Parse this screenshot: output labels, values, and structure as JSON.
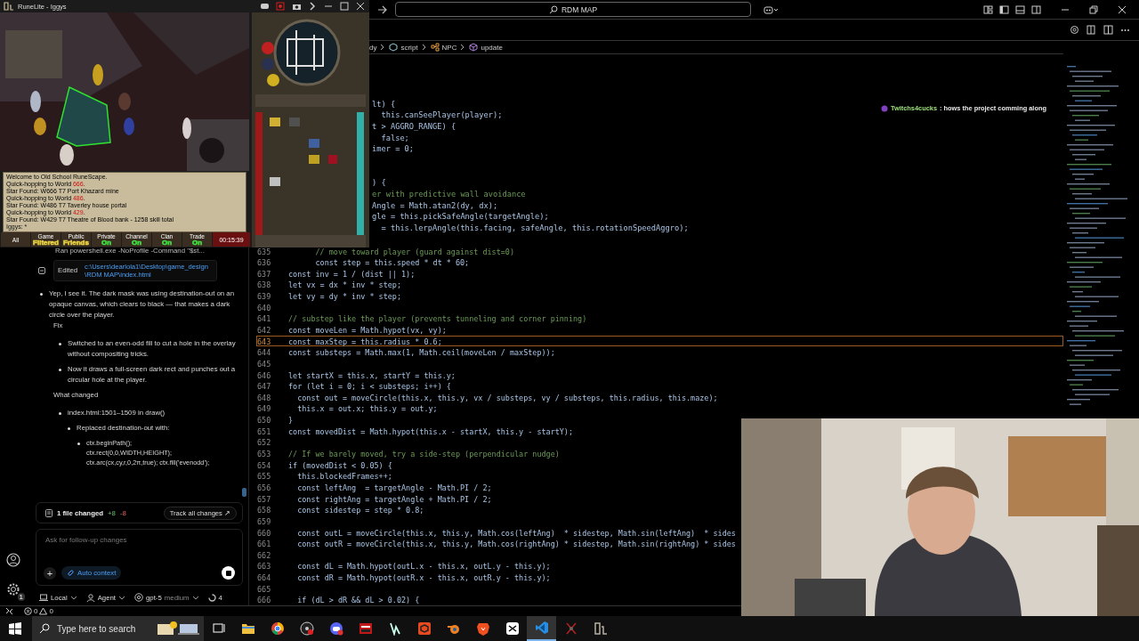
{
  "title_bar": {
    "search": "RDM MAP"
  },
  "breadcrumb": [
    {
      "kind": "plain",
      "text": "dy"
    },
    {
      "kind": "module",
      "text": "script"
    },
    {
      "kind": "class",
      "text": "NPC"
    },
    {
      "kind": "method",
      "text": "update"
    }
  ],
  "hidden_code_lines": [
    {
      "kind": "code",
      "text": "lt) {"
    },
    {
      "kind": "code",
      "text": "  this.canSeePlayer(player);"
    },
    {
      "kind": "code",
      "text": "t > AGGRO_RANGE) {"
    },
    {
      "kind": "code",
      "text": "  false;"
    },
    {
      "kind": "code",
      "text": "imer = 0;"
    },
    {
      "kind": "blank"
    },
    {
      "kind": "blank"
    },
    {
      "kind": "code",
      "text": ") {"
    },
    {
      "kind": "comment",
      "text": "er with predictive wall avoidance"
    },
    {
      "kind": "code",
      "text": "Angle = Math.atan2(dy, dx);"
    },
    {
      "kind": "code",
      "text": "gle = this.pickSafeAngle(targetAngle);"
    },
    {
      "kind": "code",
      "text": "  = this.lerpAngle(this.facing, safeAngle, this.rotationSpeedAggro);"
    }
  ],
  "code_lines": [
    {
      "number": "635",
      "kind": "comment",
      "current": false,
      "text": "      // move toward player (guard against dist=0)"
    },
    {
      "number": "636",
      "kind": "code",
      "current": false,
      "text": "      const step = this.speed * dt * 60;"
    },
    {
      "number": "637",
      "kind": "code",
      "current": false,
      "text": "const inv = 1 / (dist || 1);"
    },
    {
      "number": "638",
      "kind": "code",
      "current": false,
      "text": "let vx = dx * inv * step;"
    },
    {
      "number": "639",
      "kind": "code",
      "current": false,
      "text": "let vy = dy * inv * step;"
    },
    {
      "number": "640",
      "kind": "blank",
      "current": false
    },
    {
      "number": "641",
      "kind": "comment",
      "current": false,
      "text": "// substep like the player (prevents tunneling and corner pinning)"
    },
    {
      "number": "642",
      "kind": "code",
      "current": false,
      "text": "const moveLen = Math.hypot(vx, vy);"
    },
    {
      "number": "643",
      "kind": "code",
      "current": true,
      "text": "const maxStep = this.radius * 0.6;"
    },
    {
      "number": "644",
      "kind": "code",
      "current": false,
      "text": "const substeps = Math.max(1, Math.ceil(moveLen / maxStep));"
    },
    {
      "number": "645",
      "kind": "blank",
      "current": false
    },
    {
      "number": "646",
      "kind": "code",
      "current": false,
      "text": "let startX = this.x, startY = this.y;"
    },
    {
      "number": "647",
      "kind": "code",
      "current": false,
      "text": "for (let i = 0; i < substeps; i++) {"
    },
    {
      "number": "648",
      "kind": "code",
      "current": false,
      "text": "  const out = moveCircle(this.x, this.y, vx / substeps, vy / substeps, this.radius, this.maze);"
    },
    {
      "number": "649",
      "kind": "code",
      "current": false,
      "text": "  this.x = out.x; this.y = out.y;"
    },
    {
      "number": "650",
      "kind": "code",
      "current": false,
      "text": "}"
    },
    {
      "number": "651",
      "kind": "code",
      "current": false,
      "text": "const movedDist = Math.hypot(this.x - startX, this.y - startY);"
    },
    {
      "number": "652",
      "kind": "blank",
      "current": false
    },
    {
      "number": "653",
      "kind": "comment",
      "current": false,
      "text": "// If we barely moved, try a side-step (perpendicular nudge)"
    },
    {
      "number": "654",
      "kind": "code",
      "current": false,
      "text": "if (movedDist < 0.05) {"
    },
    {
      "number": "655",
      "kind": "code",
      "current": false,
      "text": "  this.blockedFrames++;"
    },
    {
      "number": "656",
      "kind": "code",
      "current": false,
      "text": "  const leftAng  = targetAngle - Math.PI / 2;"
    },
    {
      "number": "657",
      "kind": "code",
      "current": false,
      "text": "  const rightAng = targetAngle + Math.PI / 2;"
    },
    {
      "number": "658",
      "kind": "code",
      "current": false,
      "text": "  const sidestep = step * 0.8;"
    },
    {
      "number": "659",
      "kind": "blank",
      "current": false
    },
    {
      "number": "660",
      "kind": "code",
      "current": false,
      "text": "  const outL = moveCircle(this.x, this.y, Math.cos(leftAng)  * sidestep, Math.sin(leftAng)  * sides"
    },
    {
      "number": "661",
      "kind": "code",
      "current": false,
      "text": "  const outR = moveCircle(this.x, this.y, Math.cos(rightAng) * sidestep, Math.sin(rightAng) * sides"
    },
    {
      "number": "662",
      "kind": "blank",
      "current": false
    },
    {
      "number": "663",
      "kind": "code",
      "current": false,
      "text": "  const dL = Math.hypot(outL.x - this.x, outL.y - this.y);"
    },
    {
      "number": "664",
      "kind": "code",
      "current": false,
      "text": "  const dR = Math.hypot(outR.x - this.x, outR.y - this.y);"
    },
    {
      "number": "665",
      "kind": "blank",
      "current": false
    },
    {
      "number": "666",
      "kind": "code",
      "current": false,
      "text": "  if (dL > dR && dL > 0.02) {"
    }
  ],
  "agent_chat": {
    "tool_line": "Ran powershell.exe -NoProfile -Command \"$st...",
    "edited": {
      "label": "Edited",
      "path": "c:\\Users\\dearlola1\\Desktop\\game_design\\RDM MAP\\index.html"
    },
    "message": "Yep, I see it. The dark mask was using destination-out on an opaque canvas, which clears to black — that makes a dark circle over the player.",
    "fix_heading": "Fix",
    "fix_items": [
      "Switched to an even-odd fill to cut a hole in the overlay without compositing tricks.",
      "Now it draws a full-screen dark rect and punches out a circular hole at the player."
    ],
    "changed_heading": "What changed",
    "change": {
      "text": "index.html:1501–1509 in draw()",
      "children": [
        {
          "text": "Replaced destination-out with:",
          "code": [
            "ctx.beginPath();",
            "ctx.rect(0,0,WIDTH,HEIGHT);",
            "ctx.arc(cx,cy,r,0,2π,true); ctx.fill('evenodd');"
          ]
        }
      ]
    },
    "files_bar": {
      "summary": "1 file changed",
      "added": "+8",
      "removed": "-8",
      "track": "Track all changes ↗"
    },
    "input": {
      "placeholder": "Ask for follow-up changes",
      "add_button": "+",
      "context_button": "Auto context"
    },
    "footer": [
      {
        "kind": "local",
        "label": "Local"
      },
      {
        "kind": "agent",
        "label": "Agent"
      },
      {
        "kind": "model",
        "label": "gpt-5",
        "detail": "medium"
      },
      {
        "kind": "progress",
        "label": "4"
      }
    ]
  },
  "activity_bar": {
    "settings_badge": "1"
  },
  "status_bar": {
    "errors": "0",
    "warnings": "0"
  },
  "stream_chat": {
    "user": "Twitchs4cucks",
    "message": ": hows the project comming along"
  },
  "runelite": {
    "title": "RuneLite - Iggys",
    "chat_lines": [
      [
        {
          "kind": "normal",
          "text": "Welcome to Old School RuneScape."
        }
      ],
      [
        {
          "kind": "normal",
          "text": "Quick-hopping to World "
        },
        {
          "kind": "highlight",
          "text": "666"
        },
        {
          "kind": "normal",
          "text": "."
        }
      ],
      [
        {
          "kind": "normal",
          "text": "Star Found: W666 T7 Port Khazard mine"
        }
      ],
      [
        {
          "kind": "normal",
          "text": "Quick-hopping to World "
        },
        {
          "kind": "highlight",
          "text": "486"
        },
        {
          "kind": "normal",
          "text": "."
        }
      ],
      [
        {
          "kind": "normal",
          "text": "Star Found: W486 T7 Taverley house portal"
        }
      ],
      [
        {
          "kind": "normal",
          "text": "Quick-hopping to World "
        },
        {
          "kind": "highlight",
          "text": "429"
        },
        {
          "kind": "normal",
          "text": "."
        }
      ],
      [
        {
          "kind": "normal",
          "text": "Star Found: W429 T7 Theatre of Blood bank - 1258 skill total"
        }
      ]
    ],
    "chat_input": "Iggys: *",
    "chat_tabs": [
      {
        "title": "All"
      },
      {
        "title": "Game",
        "status": "Filtered",
        "color": "#e8d040"
      },
      {
        "title": "Public",
        "status": "Friends",
        "color": "#e8d040"
      },
      {
        "title": "Private",
        "status": "On",
        "color": "#40e040"
      },
      {
        "title": "Channel",
        "status": "On",
        "color": "#40e040"
      },
      {
        "title": "Clan",
        "status": "On",
        "color": "#40e040"
      },
      {
        "title": "Trade",
        "status": "On",
        "color": "#40e040"
      }
    ],
    "timer": "00:15:39"
  },
  "taskbar": {
    "search_placeholder": "Type here to search",
    "apps": [
      {
        "kind": "taskview",
        "selected": false
      },
      {
        "kind": "folder",
        "selected": false
      },
      {
        "kind": "chrome",
        "selected": false
      },
      {
        "kind": "obs",
        "selected": false
      },
      {
        "kind": "discord",
        "selected": false
      },
      {
        "kind": "mixer",
        "selected": false
      },
      {
        "kind": "bolt",
        "selected": false
      },
      {
        "kind": "cube",
        "selected": false
      },
      {
        "kind": "blender",
        "selected": false
      },
      {
        "kind": "brave",
        "selected": false
      },
      {
        "kind": "capcut",
        "selected": false
      },
      {
        "kind": "vscode",
        "selected": true
      },
      {
        "kind": "sword",
        "selected": false
      },
      {
        "kind": "runelite",
        "selected": false
      }
    ]
  }
}
